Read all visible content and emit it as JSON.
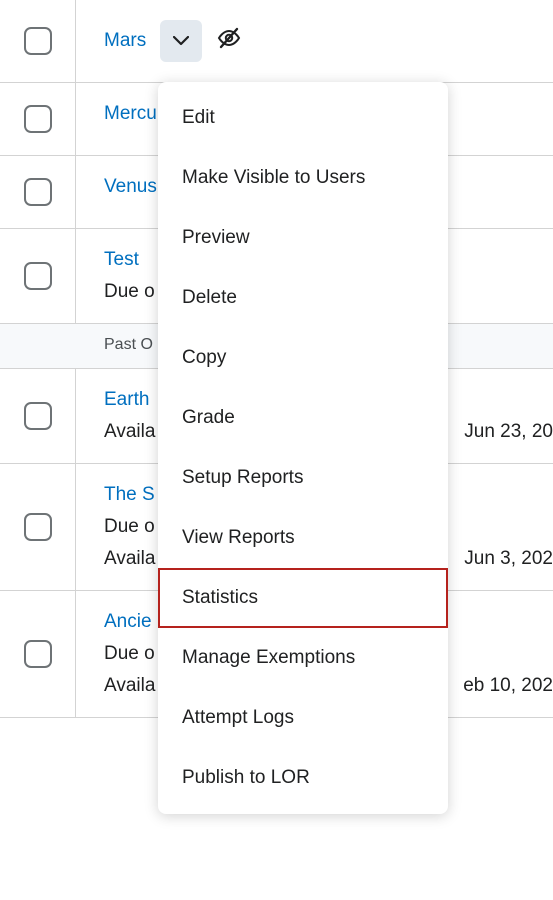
{
  "rows": [
    {
      "title": "Mars",
      "has_chevron": true,
      "has_hidden_icon": true
    },
    {
      "title": "Mercu"
    },
    {
      "title": "Venus"
    },
    {
      "title": "Test",
      "meta1": "Due o"
    },
    {
      "section": true,
      "label": "Past O"
    },
    {
      "title": "Earth",
      "meta1": "Availa",
      "right": "Jun 23, 20"
    },
    {
      "title": "The S",
      "meta1": "Due o",
      "meta2": "Availa",
      "right": "Jun 3, 202"
    },
    {
      "title": "Ancie",
      "meta1": "Due o",
      "meta2": "Availa",
      "right": "eb 10, 202"
    }
  ],
  "dropdown": {
    "items": [
      "Edit",
      "Make Visible to Users",
      "Preview",
      "Delete",
      "Copy",
      "Grade",
      "Setup Reports",
      "View Reports",
      "Statistics",
      "Manage Exemptions",
      "Attempt Logs",
      "Publish to LOR"
    ],
    "highlighted": "Statistics"
  }
}
